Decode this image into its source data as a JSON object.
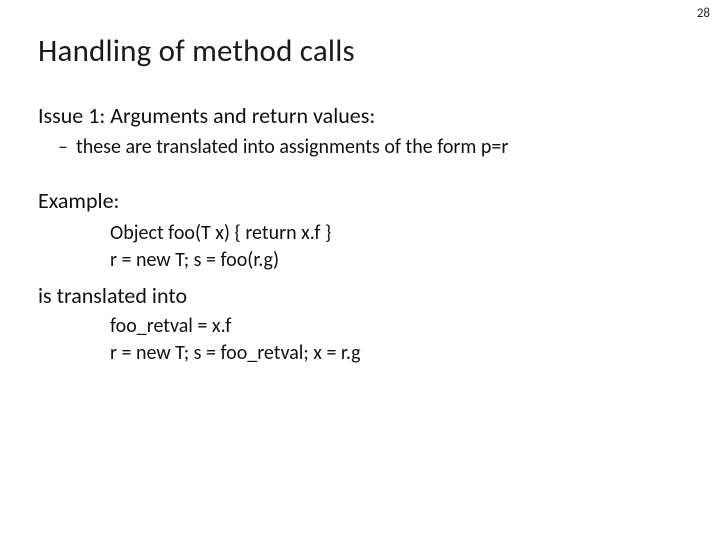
{
  "pageNumber": "28",
  "title": "Handling of method calls",
  "issueHeading": "Issue 1: Arguments and return values:",
  "bulletDash": "–",
  "bulletText": "these are translated into assignments of the form p=r",
  "exampleHeading": "Example:",
  "exampleCode1": "Object foo(T x) { return x.f }",
  "exampleCode2": "r = new T; s = foo(r.g)",
  "translatedLabel": "is translated into",
  "translatedCode1": "foo_retval = x.f",
  "translatedCode2": "r = new T; s = foo_retval; x = r.g"
}
